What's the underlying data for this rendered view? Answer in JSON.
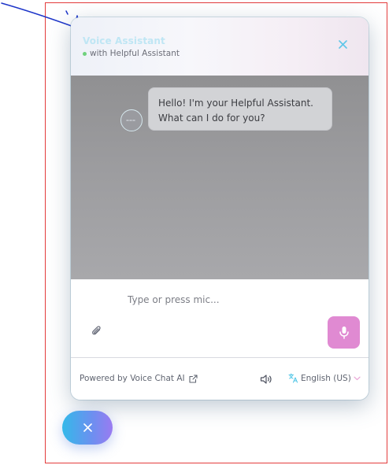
{
  "header": {
    "title": "Voice Assistant",
    "subtitle": "with Helpful Assistant"
  },
  "chat": {
    "messages": [
      {
        "sender": "bot",
        "text": "Hello! I'm your Helpful Assistant. What can I do for you?"
      }
    ]
  },
  "input": {
    "placeholder": "Type or press mic...",
    "value": ""
  },
  "footer": {
    "powered_by": "Powered by Voice Chat AI",
    "language": "English (US)"
  },
  "icons": {
    "close": "close-icon",
    "attach": "paperclip-icon",
    "mic": "microphone-icon",
    "speaker": "speaker-icon",
    "external_link": "external-link-icon",
    "translate": "translate-icon",
    "chevron": "chevron-down-icon"
  },
  "colors": {
    "accent_cyan": "#34b9e9",
    "accent_purple": "#9a7bf1",
    "mic_button": "#e08ad2",
    "status_online": "#6fd17c",
    "frame_red": "#e33b3b",
    "annotation_blue": "#1d35c9"
  }
}
